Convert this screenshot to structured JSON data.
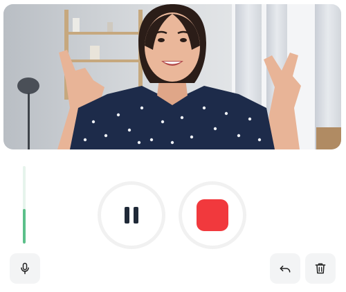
{
  "recorder": {
    "mic_level": 0.45,
    "icons": {
      "mic": "microphone-icon",
      "pause": "pause-icon",
      "record": "stop-record-icon",
      "undo": "undo-icon",
      "delete": "trash-icon"
    },
    "colors": {
      "record": "#f1393d",
      "level": "#5cc08a",
      "pause": "#1f2937"
    }
  }
}
